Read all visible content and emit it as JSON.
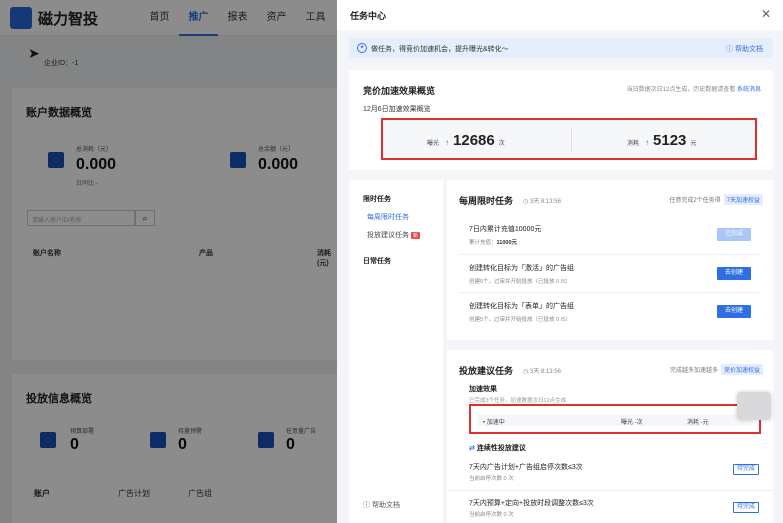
{
  "app": {
    "name": "磁力智投"
  },
  "nav": [
    "首页",
    "推广",
    "报表",
    "资产",
    "工具"
  ],
  "nav_active": "推广",
  "enterprise": "企业ID：-1",
  "account_overview": {
    "title": "账户数据概览",
    "total_cost": {
      "label": "总消耗（元）",
      "value": "0.000",
      "sub": "日同比 -"
    },
    "total_balance": {
      "label": "总余额（元）",
      "value": "0.000"
    }
  },
  "search": {
    "placeholder": "请输入账户ID/名称"
  },
  "table": {
    "cols": [
      "账户名称",
      "产品",
      "消耗(元)"
    ]
  },
  "delivery": {
    "title": "投放信息概览",
    "stats": [
      {
        "label": "预算部署",
        "value": "0"
      },
      {
        "label": "待量预警",
        "value": "0"
      },
      {
        "label": "任意量广告",
        "value": "0"
      }
    ],
    "tabs": [
      "账户",
      "广告计划",
      "广告组"
    ]
  },
  "drawer": {
    "title": "任务中心",
    "banner": "做任务，得竞价加速机会，提升曝光&转化～",
    "help": "帮助文档",
    "overview": {
      "title": "竞价加速效果概览",
      "note": "当日数据次日12点生成，历史数据请查看",
      "note_link": "系统消息",
      "date": "12月6日加速效果概览",
      "exposure": {
        "label": "曝光",
        "value": "12686",
        "unit": "次"
      },
      "cost": {
        "label": "消耗",
        "value": "5123",
        "unit": "元"
      }
    },
    "left_nav": {
      "group1": "限时任务",
      "item1": "每周限时任务",
      "item2": "投放建议任务",
      "item2_badge": "新",
      "group2": "日常任务",
      "help": "帮助文档"
    },
    "weekly": {
      "title": "每周限时任务",
      "timer": "3天 8:13:56",
      "right": "任意完成2个任务得",
      "tag": "7天加速权益",
      "tasks": [
        {
          "title": "7日内累计充值10000元",
          "sub_label": "累计充值：",
          "sub_value": "11000元",
          "btn": "已完成"
        },
        {
          "title": "创建转化目标为「激活」的广告组",
          "sub": "创建5个，过审并开始投放（已投放 0 /5）",
          "btn": "去创建"
        },
        {
          "title": "创建转化目标为「表单」的广告组",
          "sub": "创建5个，过审并开始投放（已投放 0 /5）",
          "btn": "去创建"
        }
      ]
    },
    "suggest": {
      "title": "投放建议任务",
      "timer": "3天 8:13:56",
      "right": "完成越多加速越多",
      "tag": "竞价加速权益",
      "accel_title": "加速效果",
      "accel_note": "已完成3个任务，加速数据次日12点生成",
      "row_status": "加速中",
      "row_exposure": "曝光 -次",
      "row_cost": "消耗 -元",
      "sub_title": "连续性投放建议",
      "items": [
        {
          "title": "7天内广告计划+广告组启停次数≤3次",
          "sub": "当前启停次数 0 次",
          "btn": "待完成"
        },
        {
          "title": "7天内预算+定向+投放时段调整次数≤3次",
          "sub": "当前启停次数 0 次",
          "btn": "待完成"
        }
      ]
    }
  }
}
